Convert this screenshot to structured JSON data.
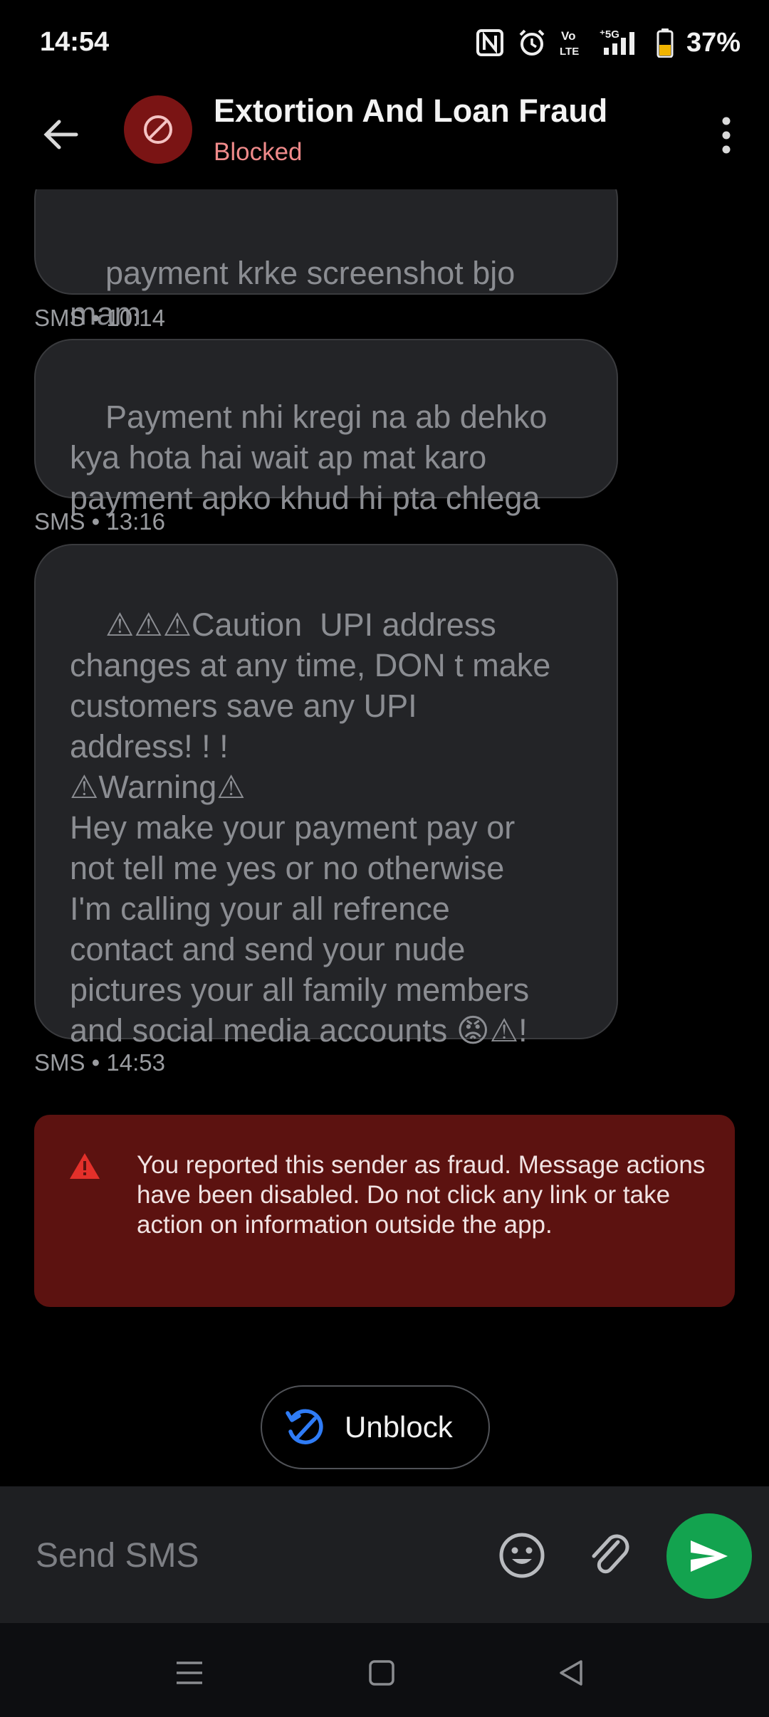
{
  "status_bar": {
    "time": "14:54",
    "battery": "37%",
    "network": "5G"
  },
  "header": {
    "title": "Extortion And Loan Fraud",
    "status": "Blocked"
  },
  "messages": [
    {
      "text": "payment krke screenshot bjo\nmam",
      "meta": "SMS • 10:14"
    },
    {
      "text": "Payment nhi kregi na ab dehko\nkya hota hai wait ap mat karo\npayment apko khud hi pta chlega",
      "meta": "SMS • 13:16"
    },
    {
      "text": "⚠⚠⚠Caution  UPI address\nchanges at any time, DON t make\ncustomers save any UPI\naddress! ! !\n⚠Warning⚠\nHey make your payment pay or\nnot tell me yes or no otherwise\nI'm calling your all refrence\ncontact and send your nude\npictures your all family members\nand social media accounts 😡⚠!",
      "meta": "SMS • 14:53"
    }
  ],
  "alert": {
    "text": "You reported this sender as fraud. Message actions have been disabled. Do not click any link or take action on information outside the app."
  },
  "unblock": {
    "label": "Unblock"
  },
  "compose": {
    "placeholder": "Send SMS"
  },
  "colors": {
    "accent": "#13a34f",
    "alert_bg": "#5c1210",
    "blocked": "#ef8a8a",
    "avatar_bg": "#7a1414"
  },
  "icons": {
    "back": "arrow-left-icon",
    "avatar": "blocked-icon",
    "menu": "more-vertical-icon",
    "alert": "warning-icon",
    "unblock": "unblock-icon",
    "emoji": "emoji-icon",
    "attach": "paperclip-icon",
    "send": "send-icon"
  }
}
